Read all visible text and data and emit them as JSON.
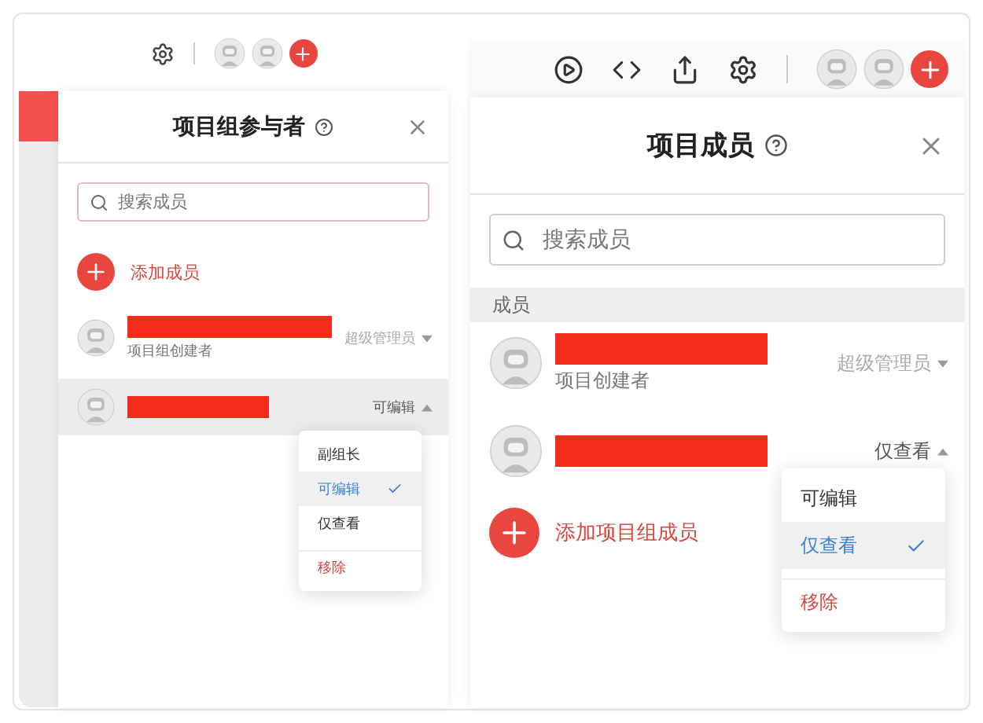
{
  "left": {
    "title": "项目组参与者",
    "search": {
      "placeholder": "搜索成员"
    },
    "add_label": "添加成员",
    "members": [
      {
        "subtitle": "项目组创建者",
        "role": "超级管理员",
        "disabled": true,
        "expanded": false,
        "hovered": false
      },
      {
        "role": "可编辑",
        "disabled": false,
        "expanded": true,
        "hovered": true
      }
    ],
    "menu": [
      {
        "label": "副组长",
        "kind": "option",
        "selected": false
      },
      {
        "label": "可编辑",
        "kind": "option",
        "selected": true
      },
      {
        "label": "仅查看",
        "kind": "option",
        "selected": false
      },
      {
        "label": "移除",
        "kind": "danger",
        "selected": false
      }
    ]
  },
  "right": {
    "title": "项目成员",
    "search": {
      "placeholder": "搜索成员"
    },
    "section": "成员",
    "add_label": "添加项目组成员",
    "members": [
      {
        "subtitle": "项目创建者",
        "role": "超级管理员",
        "disabled": true,
        "expanded": false,
        "hovered": false
      },
      {
        "role": "仅查看",
        "disabled": false,
        "expanded": true,
        "hovered": false
      }
    ],
    "menu": [
      {
        "label": "可编辑",
        "kind": "option",
        "selected": false
      },
      {
        "label": "仅查看",
        "kind": "option",
        "selected": true
      },
      {
        "label": "移除",
        "kind": "danger",
        "selected": false
      }
    ]
  }
}
